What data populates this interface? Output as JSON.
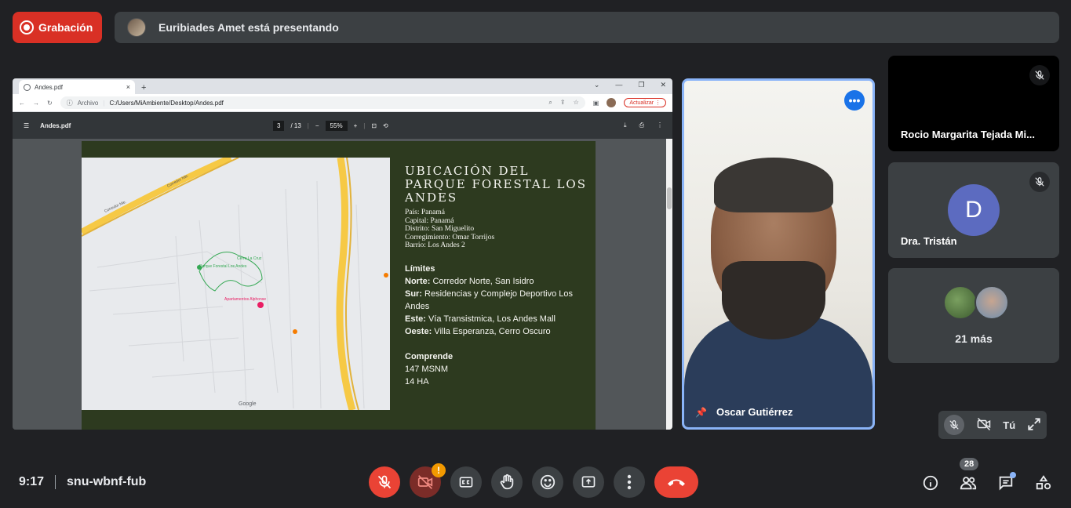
{
  "top": {
    "record_label": "Grabación",
    "presenter_text": "Euribiades Amet está presentando"
  },
  "browser": {
    "tab_title": "Andes.pdf",
    "tab_close": "×",
    "new_tab": "+",
    "url_label": "Archivo",
    "url": "C:/Users/MiAmbiente/Desktop/Andes.pdf",
    "update_label": "Actualizar",
    "pdf_title": "Andes.pdf",
    "page_current": "3",
    "page_total": "/ 13",
    "zoom": "55%",
    "zoom_out": "−",
    "zoom_in": "+"
  },
  "slide": {
    "title": "UBICACIÓN DEL PARQUE FORESTAL LOS ANDES",
    "info": [
      "País: Panamá",
      "Capital: Panamá",
      "Distrito: San Miguelito",
      "Corregimiento: Omar Torrijos",
      "Barrio: Los Andes 2"
    ],
    "limits_title": "Límites",
    "limits": [
      {
        "label": "Norte:",
        "text": " Corredor Norte, San Isidro"
      },
      {
        "label": "Sur:",
        "text": " Residencias y Complejo Deportivo Los Andes"
      },
      {
        "label": "Este:",
        "text": " Vía Transistmica, Los Andes Mall"
      },
      {
        "label": "Oeste:",
        "text": " Villa Esperanza, Cerro Oscuro"
      }
    ],
    "includes_title": "Comprende",
    "includes": [
      "147 MSNM",
      "14 HA"
    ],
    "map_labels": {
      "corredor1": "Corredor Nte.",
      "corredor2": "Corredor Nte.",
      "park": "Parque Forestal Los Andes",
      "cerro": "Cerro La Cruz",
      "apartments": "Apartamentos Alphonse",
      "google": "Google"
    }
  },
  "speaker": {
    "name": "Oscar Gutiérrez",
    "more_label": "•••"
  },
  "tiles": [
    {
      "name": "Rocio Margarita Tejada Mi..."
    },
    {
      "name": "Dra. Tristán",
      "initial": "D"
    },
    {
      "more": "21 más"
    }
  ],
  "self_view": {
    "label": "Tú"
  },
  "meeting": {
    "time": "9:17",
    "code": "snu-wbnf-fub",
    "participants_count": "28",
    "camera_warning": "!"
  },
  "colors": {
    "accent_blue": "#8ab4f8",
    "record_red": "#d93025",
    "end_call_red": "#ea4335",
    "slide_green": "#2d3a1f"
  }
}
